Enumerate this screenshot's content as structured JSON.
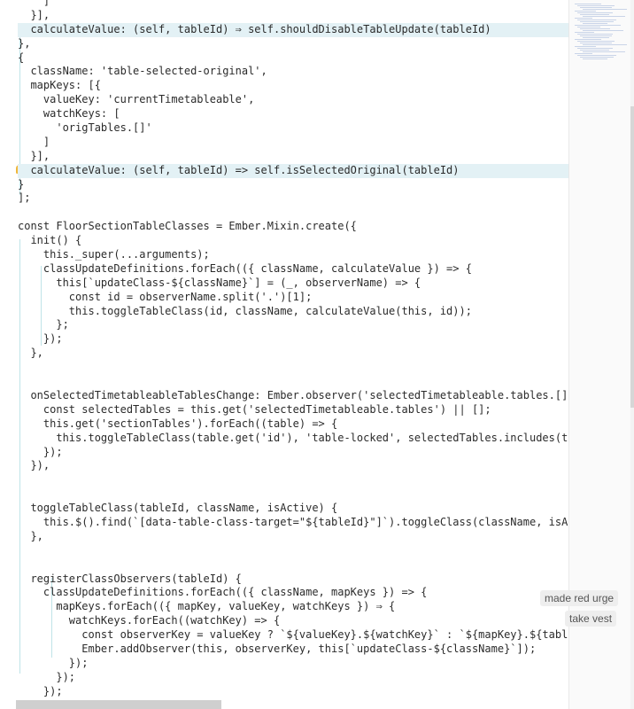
{
  "editor": {
    "lines": [
      "    ]",
      "  }],",
      "  calculateValue: (self, tableId) ⇒ self.shouldDisableTableUpdate(tableId)",
      "},",
      "{",
      "  className: 'table-selected-original',",
      "  mapKeys: [{",
      "    valueKey: 'currentTimetableable',",
      "    watchKeys: [",
      "      'origTables.[]'",
      "    ]",
      "  }],",
      "  calculateValue: (self, tableId) => self.isSelectedOriginal(tableId)",
      "}",
      "];",
      "",
      "const FloorSectionTableClasses = Ember.Mixin.create({",
      "  init() {",
      "    this._super(...arguments);",
      "    classUpdateDefinitions.forEach(({ className, calculateValue }) => {",
      "      this[`updateClass-${className}`] = (_, observerName) => {",
      "        const id = observerName.split('.')[1];",
      "        this.toggleTableClass(id, className, calculateValue(this, id));",
      "      };",
      "    });",
      "  },",
      "",
      "",
      "  onSelectedTimetableableTablesChange: Ember.observer('selectedTimetableable.tables.[]', () =>",
      "    const selectedTables = this.get('selectedTimetableable.tables') || [];",
      "    this.get('sectionTables').forEach((table) => {",
      "      this.toggleTableClass(table.get('id'), 'table-locked', selectedTables.includes(table));",
      "    });",
      "  }),",
      "",
      "",
      "  toggleTableClass(tableId, className, isActive) {",
      "    this.$().find(`[data-table-class-target=\"${tableId}\"]`).toggleClass(className, isActive);",
      "  },",
      "",
      "",
      "  registerClassObservers(tableId) {",
      "    classUpdateDefinitions.forEach(({ className, mapKeys }) => {",
      "      mapKeys.forEach(({ mapKey, valueKey, watchKeys }) ⇒ {",
      "        watchKeys.forEach((watchKey) => {",
      "          const observerKey = valueKey ? `${valueKey}.${watchKey}` : `${mapKey}.${tableId}",
      "          Ember.addObserver(this, observerKey, this[`updateClass-${className}`]);",
      "        });",
      "      });",
      "    });",
      "  }",
      "});"
    ]
  },
  "chips": {
    "first": "made red urge",
    "second": "take vest"
  }
}
